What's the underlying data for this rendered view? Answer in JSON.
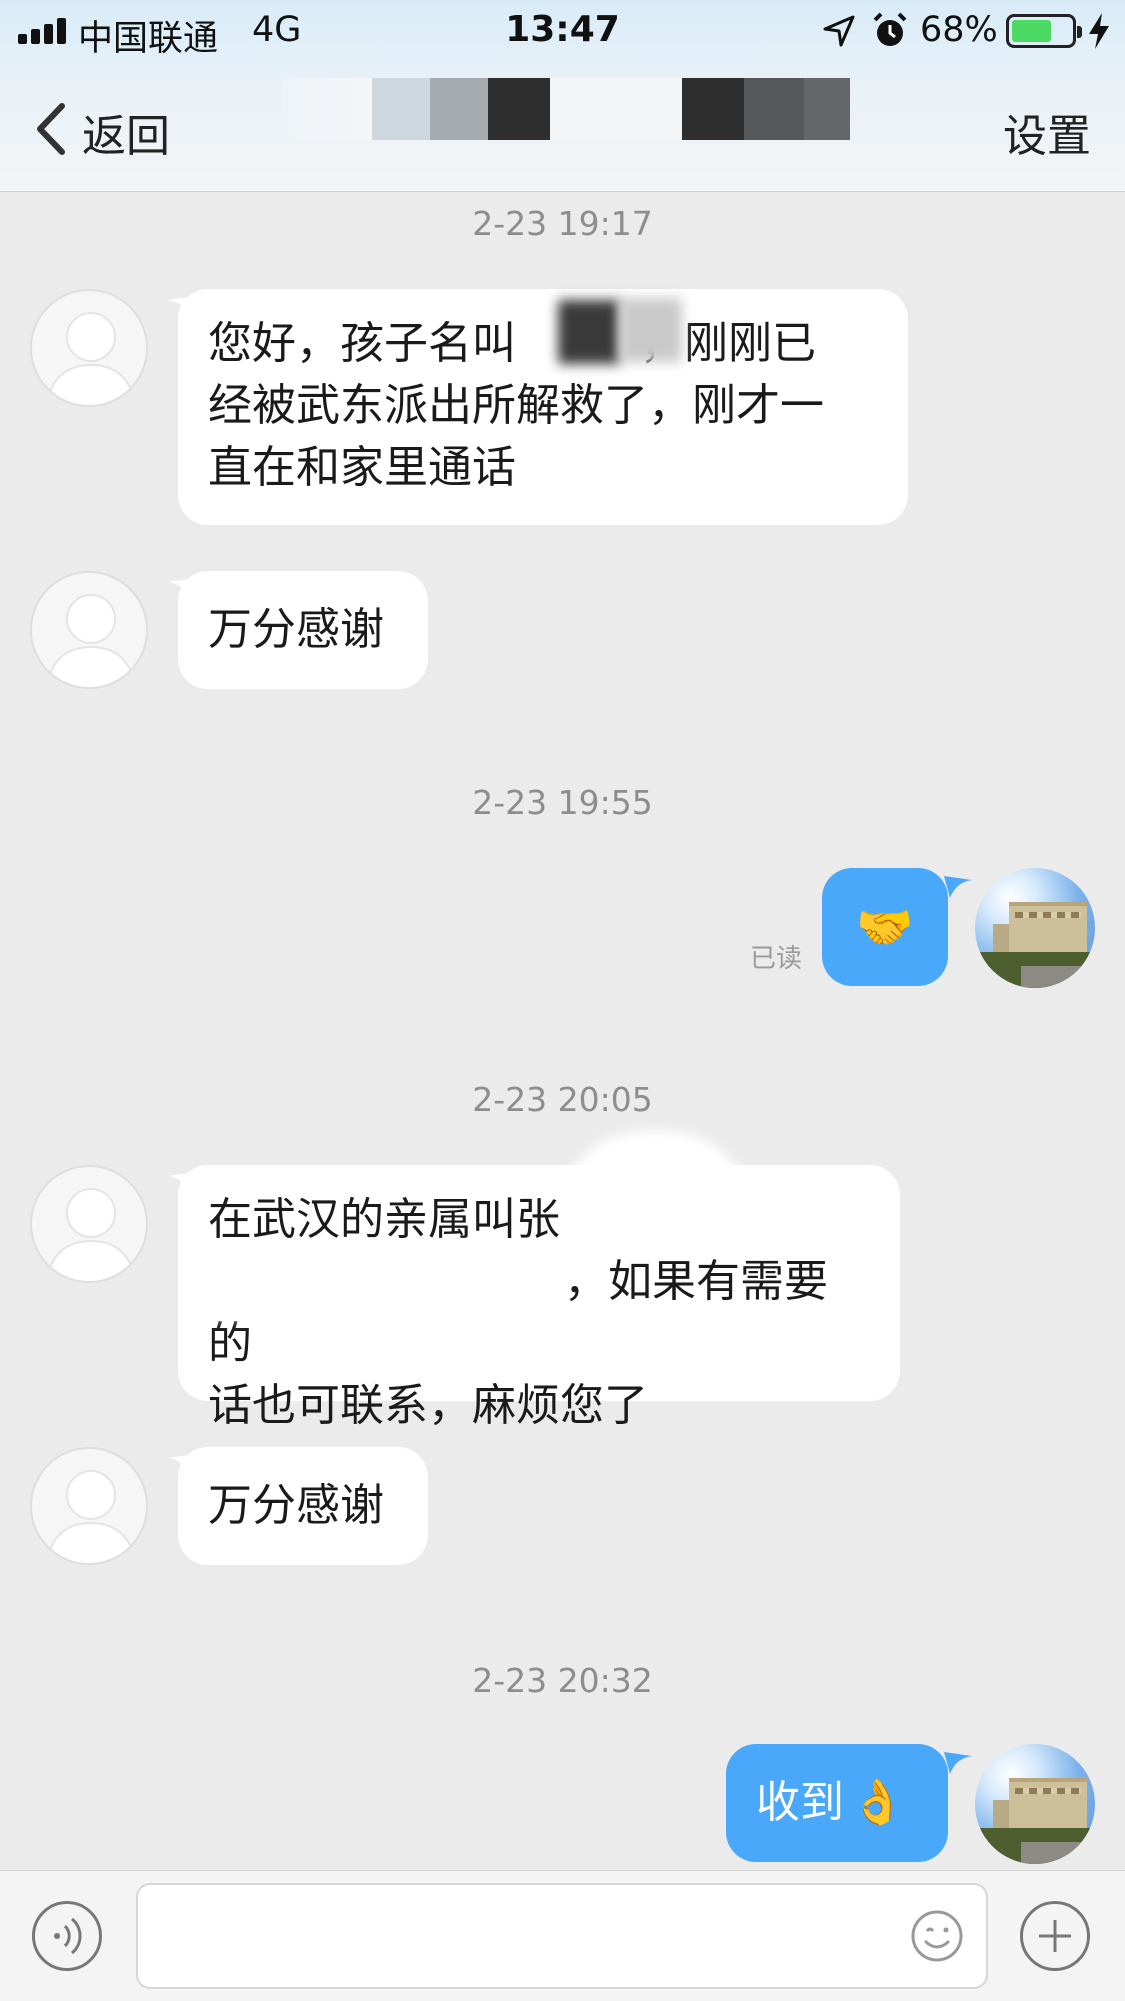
{
  "status_bar": {
    "carrier": "中国联通",
    "network": "4G",
    "time": "13:47",
    "battery_percent": "68%",
    "battery_level": 0.68
  },
  "nav": {
    "back_label": "返回",
    "settings_label": "设置"
  },
  "messages": [
    {
      "kind": "timestamp",
      "text": "2-23 19:17"
    },
    {
      "kind": "incoming",
      "lines": [
        "您好，孩子名叫",
        "，刚刚已",
        "经被武东派出所解救了，刚才一",
        "直在和家里通话"
      ]
    },
    {
      "kind": "incoming",
      "text": "万分感谢"
    },
    {
      "kind": "timestamp",
      "text": "2-23 19:55"
    },
    {
      "kind": "outgoing",
      "emoji": "🤝",
      "status": "已读"
    },
    {
      "kind": "timestamp",
      "text": "2-23 20:05"
    },
    {
      "kind": "incoming",
      "lines": [
        "在武汉的亲属叫张",
        "，如果有需要的",
        "话也可联系，麻烦您了"
      ]
    },
    {
      "kind": "incoming",
      "text": "万分感谢"
    },
    {
      "kind": "timestamp",
      "text": "2-23 20:32"
    },
    {
      "kind": "outgoing",
      "text": "收到",
      "emoji": "👌"
    }
  ],
  "input_bar": {
    "value": ""
  },
  "colors": {
    "outgoing_bubble": "#4aa8fb",
    "incoming_bubble": "#ffffff",
    "background": "#ebebeb",
    "battery": "#4cd964"
  },
  "icons": {
    "status": [
      "signal-icon",
      "location-arrow-icon",
      "alarm-icon",
      "battery-icon",
      "charging-icon"
    ],
    "nav": [
      "chevron-left-icon"
    ],
    "input": [
      "voice-icon",
      "emoji-icon",
      "plus-icon"
    ]
  }
}
